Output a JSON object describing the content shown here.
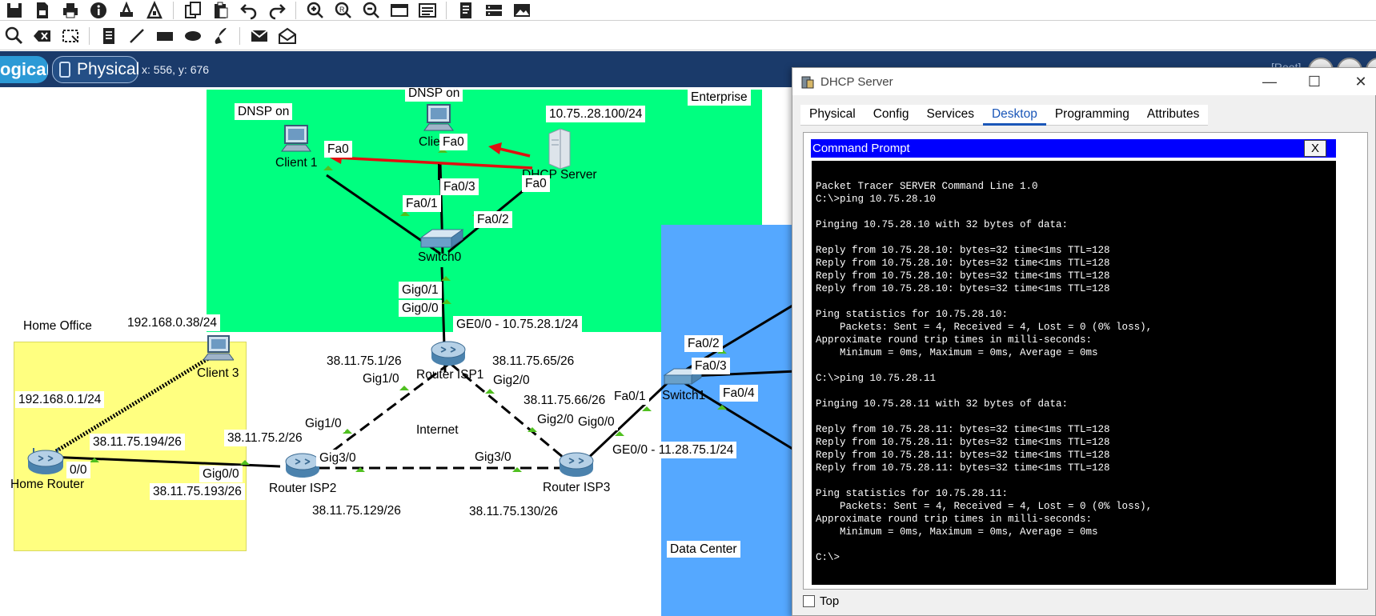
{
  "mode_bar": {
    "logical_label": "ogical",
    "physical_label": "Physical",
    "coords": "x: 556, y: 676",
    "root_label": "[Root]"
  },
  "clusters": {
    "enterprise": "Enterprise",
    "internet": "Internet",
    "home_office": "Home Office",
    "data_center": "Data Center"
  },
  "devices": {
    "client1": "Client 1",
    "client_partial": "Clie",
    "dhcp_server": "DHCP Server",
    "switch0": "Switch0",
    "router_isp1": "Router ISP1",
    "router_isp2": "Router ISP2",
    "router_isp3": "Router ISP3",
    "switch1": "Switch1",
    "home_router": "Home Router",
    "client3": "Client 3"
  },
  "notes": {
    "dnsp_on_1": "DNSP on",
    "dnsp_on_2": "DNSP on",
    "server_ip": "10.75..28.100/24",
    "ge00_isp1": "GE0/0 - 10.75.28.1/24",
    "isp1_gig10_ip": "38.11.75.1/26",
    "isp1_gig20_ip": "38.11.75.65/26",
    "isp3_gig20_ip": "38.11.75.66/26",
    "isp2_gig10_ip": "38.11.75.2/26",
    "home_router_ip": "38.11.75.194/26",
    "isp2_gig00_ip": "38.11.75.193/26",
    "isp2_gig30_ip": "38.11.75.129/26",
    "isp3_gig30_ip": "38.11.75.130/26",
    "isp3_ge00": "GE0/0 - 11.28.75.1/24",
    "client3_ip": "192.168.0.38/24",
    "home_lan_ip": "192.168.0.1/24"
  },
  "ports": {
    "c1_fa0": "Fa0",
    "cl_fa0": "Fa0",
    "srv_fa0": "Fa0",
    "sw0_fa01": "Fa0/1",
    "sw0_fa03": "Fa0/3",
    "sw0_fa02": "Fa0/2",
    "sw0_gig01": "Gig0/1",
    "isp1_gig00": "Gig0/0",
    "isp1_gig10": "Gig1/0",
    "isp1_gig20": "Gig2/0",
    "isp2_gig10": "Gig1/0",
    "isp2_gig30": "Gig3/0",
    "isp2_gig00": "Gig0/0",
    "isp3_gig20": "Gig2/0",
    "isp3_gig30": "Gig3/0",
    "isp3_gig00": "Gig0/0",
    "sw1_fa01": "Fa0/1",
    "sw1_fa02": "Fa0/2",
    "sw1_fa03": "Fa0/3",
    "sw1_fa04": "Fa0/4",
    "home_00": "0/0"
  },
  "dhcp_window": {
    "title": "DHCP Server",
    "minimize": "—",
    "maximize": "☐",
    "close": "✕",
    "tabs": [
      "Physical",
      "Config",
      "Services",
      "Desktop",
      "Programming",
      "Attributes"
    ],
    "active_tab": "Desktop",
    "command_prompt_title": "Command Prompt",
    "command_prompt_close": "X",
    "top_label": "Top",
    "terminal_lines": [
      "Packet Tracer SERVER Command Line 1.0",
      "C:\\>ping 10.75.28.10",
      "",
      "Pinging 10.75.28.10 with 32 bytes of data:",
      "",
      "Reply from 10.75.28.10: bytes=32 time<1ms TTL=128",
      "Reply from 10.75.28.10: bytes=32 time<1ms TTL=128",
      "Reply from 10.75.28.10: bytes=32 time<1ms TTL=128",
      "Reply from 10.75.28.10: bytes=32 time<1ms TTL=128",
      "",
      "Ping statistics for 10.75.28.10:",
      "    Packets: Sent = 4, Received = 4, Lost = 0 (0% loss),",
      "Approximate round trip times in milli-seconds:",
      "    Minimum = 0ms, Maximum = 0ms, Average = 0ms",
      "",
      "C:\\>ping 10.75.28.11",
      "",
      "Pinging 10.75.28.11 with 32 bytes of data:",
      "",
      "Reply from 10.75.28.11: bytes=32 time<1ms TTL=128",
      "Reply from 10.75.28.11: bytes=32 time<1ms TTL=128",
      "Reply from 10.75.28.11: bytes=32 time<1ms TTL=128",
      "Reply from 10.75.28.11: bytes=32 time<1ms TTL=128",
      "",
      "Ping statistics for 10.75.28.11:",
      "    Packets: Sent = 4, Received = 4, Lost = 0 (0% loss),",
      "Approximate round trip times in milli-seconds:",
      "    Minimum = 0ms, Maximum = 0ms, Average = 0ms",
      "",
      "C:\\>"
    ]
  },
  "colors": {
    "enterprise_bg": "#00ff80",
    "datacenter_bg": "#55a8ff",
    "home_office_bg": "#ffff80",
    "mode_bar_bg": "#1a3a6a",
    "command_prompt_header": "#0000ff",
    "pdu_arrow": "#e01010",
    "port_up": "#50c020"
  }
}
